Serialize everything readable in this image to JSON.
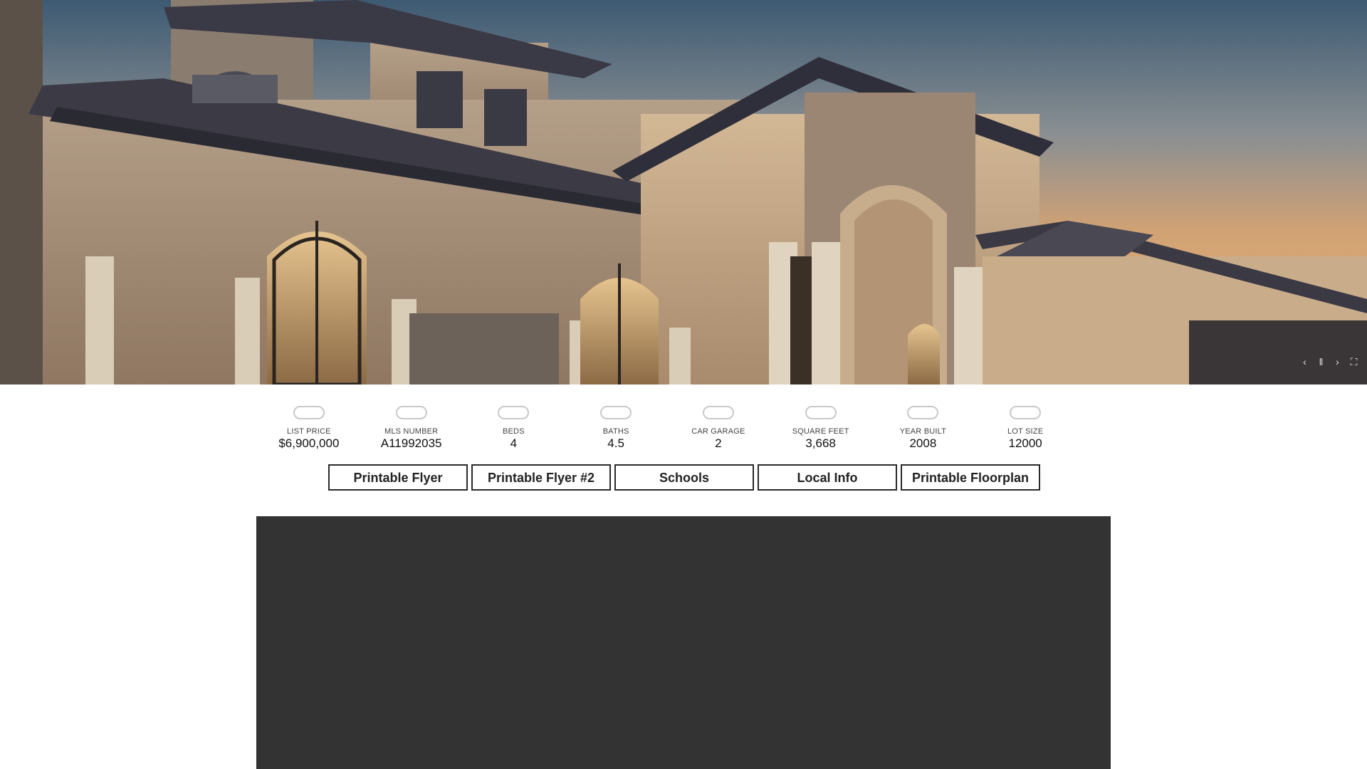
{
  "hero": {
    "controls": [
      {
        "icon": "chevron-left-icon",
        "glyph": "‹"
      },
      {
        "icon": "pause-icon",
        "glyph": "‖"
      },
      {
        "icon": "chevron-right-icon",
        "glyph": "›"
      },
      {
        "icon": "fullscreen-icon",
        "glyph": "⛶"
      }
    ]
  },
  "stats": [
    {
      "label": "LIST PRICE",
      "value": "$6,900,000",
      "icon": "price-icon"
    },
    {
      "label": "MLS NUMBER",
      "value": "A11992035",
      "icon": "mls-icon"
    },
    {
      "label": "BEDS",
      "value": "4",
      "icon": "bed-icon"
    },
    {
      "label": "BATHS",
      "value": "4.5",
      "icon": "bath-icon"
    },
    {
      "label": "CAR GARAGE",
      "value": "2",
      "icon": "garage-icon"
    },
    {
      "label": "SQUARE FEET",
      "value": "3,668",
      "icon": "square-feet-icon"
    },
    {
      "label": "YEAR BUILT",
      "value": "2008",
      "icon": "calendar-icon"
    },
    {
      "label": "LOT SIZE",
      "value": "12000",
      "icon": "lot-size-icon"
    }
  ],
  "buttons": [
    {
      "label": "Printable Flyer"
    },
    {
      "label": "Printable Flyer #2"
    },
    {
      "label": "Schools"
    },
    {
      "label": "Local Info"
    },
    {
      "label": "Printable Floorplan"
    }
  ],
  "colors": {
    "video_panel": "#333333",
    "button_border": "#2a2a2a",
    "icon_outline": "#c9c9c9"
  }
}
